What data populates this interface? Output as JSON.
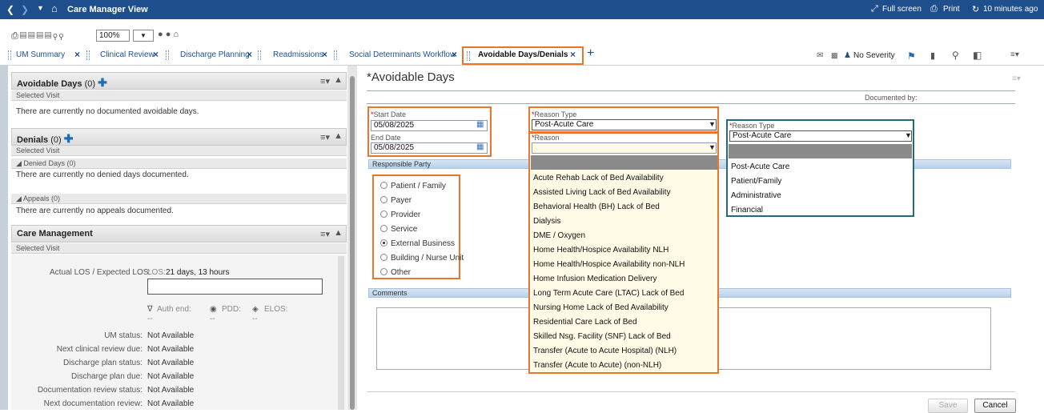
{
  "titlebar": {
    "title": "Care Manager View",
    "fullscreen": "Full screen",
    "print": "Print",
    "refresh": "10 minutes ago"
  },
  "toolbar": {
    "zoom": "100%"
  },
  "tabs": [
    "UM Summary",
    "Clinical Review",
    "Discharge Planning",
    "Readmissions",
    "Social Determinants Workflow",
    "Avoidable Days/Denials"
  ],
  "toolbar_right": {
    "severity": "No Severity"
  },
  "left": {
    "avoidable_title": "Avoidable Days",
    "avoidable_count": "(0)",
    "selected_visit": "Selected Visit",
    "avoidable_msg": "There are currently no documented avoidable days.",
    "denials_title": "Denials",
    "denials_count": "(0)",
    "denied_days": "Denied Days (0)",
    "denied_msg": "There are currently no denied days documented.",
    "appeals": "Appeals (0)",
    "appeals_msg": "There are currently no appeals documented.",
    "care_title": "Care Management",
    "los_label": "Actual LOS / Expected LOS:",
    "los_prefix": "LOS:",
    "los_value": "21 days, 13 hours",
    "auth_end": "Auth end:",
    "pdd": "PDD:",
    "elos": "ELOS:",
    "dash": "--",
    "fields": [
      {
        "label": "UM status:",
        "value": "Not Available"
      },
      {
        "label": "Next clinical review due:",
        "value": "Not Available"
      },
      {
        "label": "Discharge plan status:",
        "value": "Not Available"
      },
      {
        "label": "Discharge plan due:",
        "value": "Not Available"
      },
      {
        "label": "Documentation review status:",
        "value": "Not Available"
      },
      {
        "label": "Next documentation review:",
        "value": "Not Available"
      }
    ]
  },
  "form": {
    "title": "*Avoidable Days",
    "documented_by": "Documented by:",
    "start_label": "Start Date",
    "start_value": "05/08/2025",
    "end_label": "End Date",
    "end_value": "05/08/2025",
    "reason_type_label": "Reason Type",
    "reason_type_value": "Post-Acute Care",
    "reason_label": "Reason",
    "responsible_party": "Responsible Party",
    "parties": [
      "Patient / Family",
      "Payer",
      "Provider",
      "Service",
      "External Business",
      "Building / Nurse Unit",
      "Other"
    ],
    "comments": "Comments",
    "reasons": [
      "Acute Rehab Lack of Bed Availability",
      "Assisted Living Lack of Bed Availability",
      "Behavioral Health (BH) Lack of Bed",
      "Dialysis",
      "DME / Oxygen",
      "Home Health/Hospice Availability NLH",
      "Home Health/Hospice Availability non-NLH",
      "Home Infusion Medication Delivery",
      "Long Term Acute Care (LTAC) Lack of Bed",
      "Nursing Home Lack of Bed Availability",
      "Residential Care Lack of Bed",
      "Skilled Nsg. Facility (SNF) Lack of Bed",
      "Transfer (Acute to Acute Hospital) (NLH)",
      "Transfer (Acute to Acute) (non-NLH)"
    ],
    "reason_type2_label": "Reason Type",
    "reason_type2_value": "Post-Acute Care",
    "reason_types": [
      "Post-Acute Care",
      "Patient/Family",
      "Administrative",
      "Financial"
    ],
    "save": "Save",
    "cancel": "Cancel"
  },
  "colors": {
    "accent": "#e8762b",
    "header": "#1e4f8c",
    "teal": "#256a78"
  }
}
